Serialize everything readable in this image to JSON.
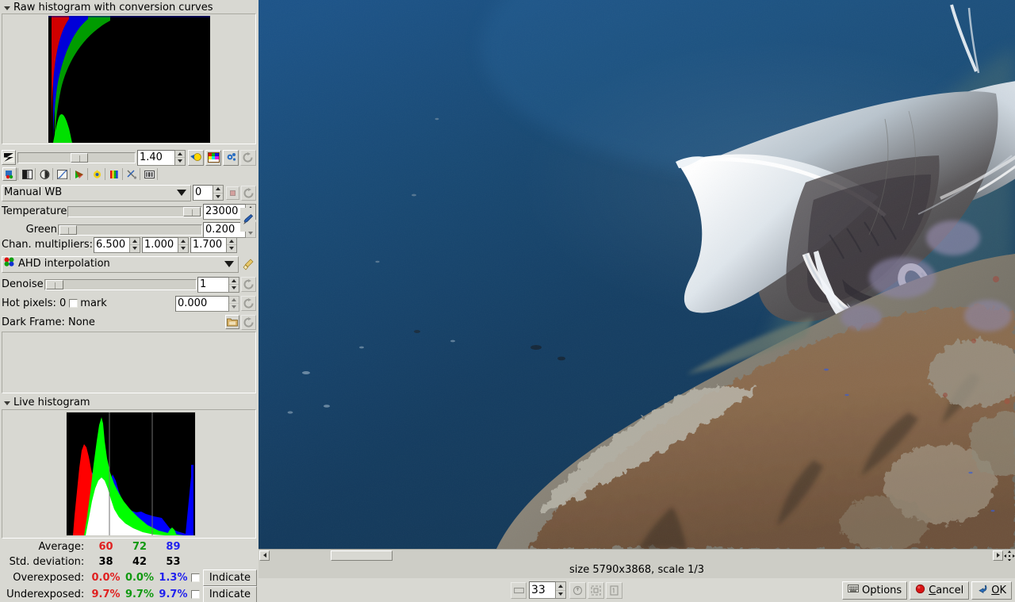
{
  "window": {
    "background": "#d8d8d2"
  },
  "raw_histogram": {
    "title": "Raw histogram with conversion curves",
    "expanded": true
  },
  "exposure_row": {
    "icon": "exposure-icon",
    "value": "1.40",
    "slider_percent": 45,
    "buttons": [
      {
        "name": "highlight-lamp-icon",
        "label": ""
      },
      {
        "name": "color-channels-icon",
        "label": ""
      },
      {
        "name": "auto-adjust-icon",
        "label": ""
      },
      {
        "name": "reset-exposure-icon",
        "label": ""
      }
    ]
  },
  "page_toolbar": {
    "tabs": [
      {
        "name": "tab-white-balance",
        "icon": "wb-icon"
      },
      {
        "name": "tab-base-curve",
        "icon": "grayscale-icon"
      },
      {
        "name": "tab-color-management",
        "icon": "target-icon"
      },
      {
        "name": "tab-curve-editor",
        "icon": "curve-icon"
      },
      {
        "name": "tab-corrections",
        "icon": "play-color-icon"
      },
      {
        "name": "tab-lightness",
        "icon": "sun-icon"
      },
      {
        "name": "tab-saturation",
        "icon": "rainbow-bars-icon"
      },
      {
        "name": "tab-crop-rotate",
        "icon": "scissors-icon"
      },
      {
        "name": "tab-exif",
        "icon": "barcode-icon"
      }
    ]
  },
  "white_balance": {
    "mode_label": "Manual WB",
    "preset_value": "0",
    "reset_icon": "reset-icon",
    "temperature": {
      "label": "Temperature",
      "value": "23000",
      "slider_percent": 95
    },
    "green": {
      "label": "Green",
      "value": "0.200",
      "slider_percent": 2
    },
    "picker_icon": "eyedropper-icon",
    "channel_multipliers": {
      "label": "Chan. multipliers:",
      "red": "6.500",
      "green": "1.000",
      "blue": "1.700"
    }
  },
  "interpolation": {
    "icon": "bayer-dots-icon",
    "label": "AHD interpolation",
    "clean_icon": "broom-icon"
  },
  "denoise": {
    "label": "Denoise",
    "value": "1",
    "slider_percent": 2,
    "reset_icon": "reset-icon"
  },
  "hot_pixels": {
    "label": "Hot pixels: 0",
    "mark_label": "mark",
    "mark_checked": false,
    "value": "0.000",
    "reset_icon": "reset-icon"
  },
  "dark_frame": {
    "label": "Dark Frame: None",
    "browse_icon": "folder-icon",
    "reset_icon": "reset-icon"
  },
  "live_histogram": {
    "title": "Live histogram",
    "expanded": true
  },
  "statistics": {
    "rows": [
      {
        "label": "Average:",
        "r": "60",
        "g": "72",
        "b": "89",
        "indicate": null
      },
      {
        "label": "Std. deviation:",
        "r": "38",
        "g": "42",
        "b": "53",
        "indicate": null
      },
      {
        "label": "Overexposed:",
        "r": "0.0%",
        "g": "0.0%",
        "b": "1.3%",
        "indicate": "Indicate",
        "checked": false
      },
      {
        "label": "Underexposed:",
        "r": "9.7%",
        "g": "9.7%",
        "b": "9.7%",
        "indicate": "Indicate",
        "checked": false
      }
    ],
    "colors": {
      "red": "#e02020",
      "green": "#119911",
      "blue": "#2222ee"
    }
  },
  "image_view": {
    "alt": "Underwater photo of a manta ray gliding above a coral reef"
  },
  "scrollbar": {
    "left_arrow": "scroll-left-icon",
    "right_arrow": "scroll-right-icon",
    "grip": "resize-grip-icon"
  },
  "status": {
    "text": "size 5790x3868, scale 1/3"
  },
  "bottom_toolbar": {
    "fit_icon": "fit-window-icon",
    "zoom_value": "33",
    "zoom_buttons": [
      {
        "name": "zoom-fit-icon"
      },
      {
        "name": "zoom-shrink-icon"
      },
      {
        "name": "zoom-100-icon"
      }
    ],
    "options_label": "Options",
    "options_icon": "options-icon",
    "cancel_label": "Cancel",
    "cancel_icon": "cancel-dot-icon",
    "ok_label": "OK",
    "ok_icon": "ok-arrow-icon"
  },
  "chart_data": [
    {
      "type": "area",
      "id": "raw-histogram",
      "title": "Raw histogram with conversion curves",
      "xlabel": "",
      "ylabel": "",
      "grid": false,
      "legend": "none",
      "series": [
        {
          "name": "Red",
          "color": "#e00000"
        },
        {
          "name": "Blue",
          "color": "#0000e0"
        },
        {
          "name": "Green",
          "color": "#00a000"
        }
      ],
      "note": "Three conversion curves rising steeply from the left edge on a black plot; red leftmost/steepest, then blue, then green widest."
    },
    {
      "type": "area",
      "id": "live-histogram",
      "title": "Live histogram",
      "xlabel": "",
      "ylabel": "",
      "grid": true,
      "legend": "none",
      "xlim": [
        0,
        255
      ],
      "series": [
        {
          "name": "Red",
          "color": "#ff0000",
          "peak_x": 42,
          "peak_y": 0.62
        },
        {
          "name": "Green",
          "color": "#00ff00",
          "peak_x": 78,
          "peak_y": 1.0
        },
        {
          "name": "Blue",
          "color": "#0000ff",
          "peak_x": 128,
          "peak_y": 0.36
        }
      ],
      "note": "Overlaid RGB histogram; overlaps render as white/yellow/cyan/magenta."
    }
  ]
}
